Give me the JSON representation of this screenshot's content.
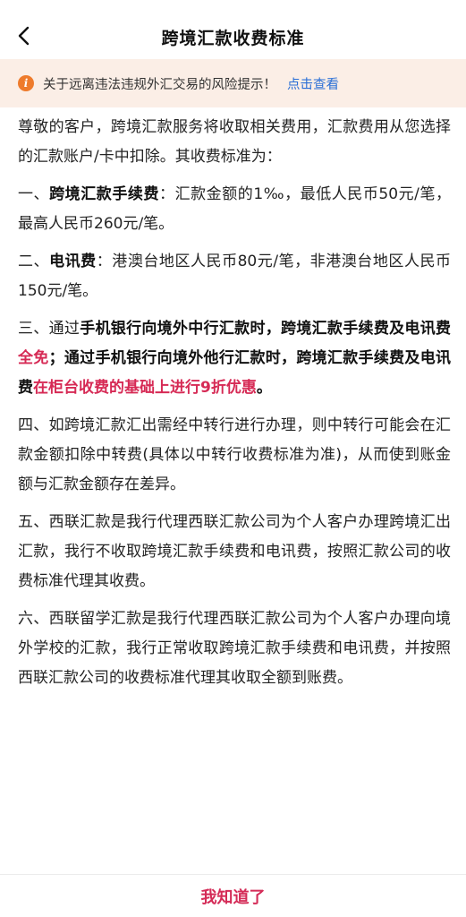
{
  "header": {
    "title": "跨境汇款收费标准"
  },
  "notice": {
    "icon": "info-icon",
    "icon_glyph": "i",
    "text": "关于远离违法违规外汇交易的风险提示！",
    "link": "点击查看"
  },
  "content": {
    "intro": "尊敬的客户，跨境汇款服务将收取相关费用，汇款费用从您选择的汇款账户/卡中扣除。其收费标准为：",
    "item1": {
      "prefix": "一、",
      "label": "跨境汇款手续费",
      "text": "：汇款金额的1‰，最低人民币50元/笔，最高人民币260元/笔。"
    },
    "item2": {
      "prefix": "二、",
      "label": "电讯费",
      "text": "：港澳台地区人民币80元/笔，非港澳台地区人民币150元/笔。"
    },
    "item3": {
      "s1": "三、通过",
      "s2": "手机银行向境外中行汇款时，跨境汇款手续费及电讯费",
      "s3": "全免",
      "s4": "；通过手机银行向境外他行汇款时，跨境汇款手续费及电讯费",
      "s5": "在柜台收费的基础上进行9折优惠",
      "s6": "。"
    },
    "item4": "四、如跨境汇款汇出需经中转行进行办理，则中转行可能会在汇款金额扣除中转费(具体以中转行收费标准为准)，从而使到账金额与汇款金额存在差异。",
    "item5": "五、西联汇款是我行代理西联汇款公司为个人客户办理跨境汇出汇款，我行不收取跨境汇款手续费和电讯费，按照汇款公司的收费标准代理其收费。",
    "item6": "六、西联留学汇款是我行代理西联汇款公司为个人客户办理向境外学校的汇款，我行正常收取跨境汇款手续费和电讯费，并按照西联汇款公司的收费标准代理其收取全额到账费。"
  },
  "footer": {
    "confirm_label": "我知道了"
  },
  "colors": {
    "accent_red": "#d62a55",
    "link_blue": "#2a6fd6",
    "notice_bg": "#fbeee6",
    "notice_icon": "#ee7b2c"
  }
}
